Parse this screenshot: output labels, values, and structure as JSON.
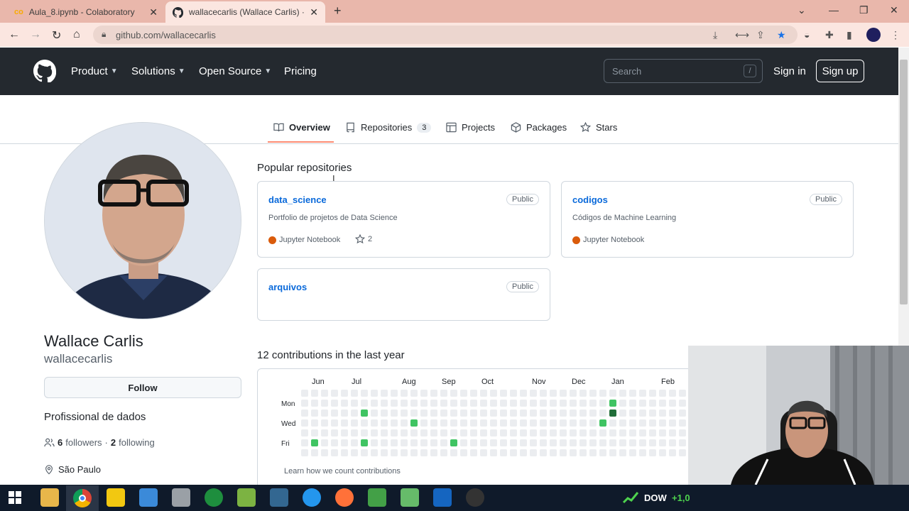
{
  "browser": {
    "tabs": [
      {
        "title": "Aula_8.ipynb - Colaboratory"
      },
      {
        "title": "wallacecarlis (Wallace Carlis) · Gi"
      }
    ],
    "url": "github.com/wallacecarlis"
  },
  "header": {
    "nav": [
      "Product",
      "Solutions",
      "Open Source",
      "Pricing"
    ],
    "search_placeholder": "Search",
    "search_shortcut": "/",
    "signin": "Sign in",
    "signup": "Sign up"
  },
  "profile_tabs": {
    "overview": "Overview",
    "repositories": "Repositories",
    "repositories_count": "3",
    "projects": "Projects",
    "packages": "Packages",
    "stars": "Stars"
  },
  "profile": {
    "name": "Wallace Carlis",
    "login": "wallacecarlis",
    "follow": "Follow",
    "bio": "Profissional de dados",
    "followers_count": "6",
    "followers_label": "followers",
    "separator": "·",
    "following_count": "2",
    "following_label": "following",
    "location": "São Paulo"
  },
  "popular": {
    "title": "Popular repositories",
    "repos": [
      {
        "name": "data_science",
        "visibility": "Public",
        "description": "Portfolio de projetos de Data Science",
        "language": "Jupyter Notebook",
        "stars": "2"
      },
      {
        "name": "codigos",
        "visibility": "Public",
        "description": "Códigos de Machine Learning",
        "language": "Jupyter Notebook"
      },
      {
        "name": "arquivos",
        "visibility": "Public"
      }
    ]
  },
  "contributions": {
    "title": "12 contributions in the last year",
    "months": [
      "Jun",
      "Jul",
      "Aug",
      "Sep",
      "Oct",
      "Nov",
      "Dec",
      "Jan",
      "Feb"
    ],
    "day_labels": [
      "Mon",
      "Wed",
      "Fri"
    ],
    "learn_link": "Learn how we count contributions",
    "active_cells": [
      {
        "week": 1,
        "day": 5,
        "level": 2
      },
      {
        "week": 6,
        "day": 2,
        "level": 2
      },
      {
        "week": 6,
        "day": 5,
        "level": 2
      },
      {
        "week": 11,
        "day": 3,
        "level": 2
      },
      {
        "week": 15,
        "day": 5,
        "level": 2
      },
      {
        "week": 30,
        "day": 3,
        "level": 2
      },
      {
        "week": 31,
        "day": 1,
        "level": 2
      },
      {
        "week": 31,
        "day": 2,
        "level": 4
      }
    ]
  },
  "taskbar": {
    "ticker": "DOW",
    "ticker_value": "+1,0"
  },
  "colors": {
    "tab_strip": "#e9b7ab",
    "header_bg": "#24292f",
    "link": "#0969da",
    "active_tab_underline": "#fd8c73",
    "contrib_empty": "#ebedf0",
    "contrib_level2": "#40c463",
    "contrib_level4": "#216e39"
  }
}
